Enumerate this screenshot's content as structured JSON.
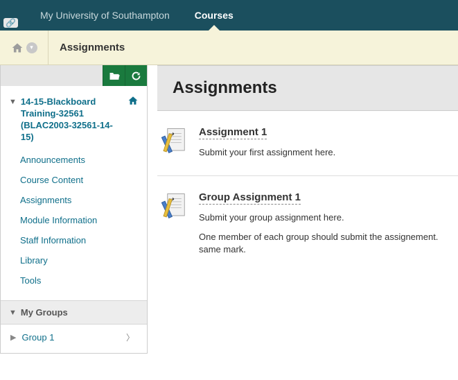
{
  "topnav": {
    "items": [
      {
        "label": "My University of Southampton",
        "active": false
      },
      {
        "label": "Courses",
        "active": true
      }
    ]
  },
  "breadcrumb": {
    "title": "Assignments"
  },
  "sidebar": {
    "course_title": "14-15-Blackboard Training-32561 (BLAC2003-32561-14-15)",
    "links": [
      "Announcements",
      "Course Content",
      "Assignments",
      "Module Information",
      "Staff Information",
      "Library",
      "Tools"
    ],
    "groups_header": "My Groups",
    "groups": [
      "Group 1"
    ]
  },
  "page": {
    "title": "Assignments",
    "items": [
      {
        "title": "Assignment 1",
        "lines": [
          "Submit your first assignment here."
        ]
      },
      {
        "title": "Group Assignment 1",
        "lines": [
          "Submit your group assignment here.",
          "One member of each group should submit the assignement. same mark."
        ]
      }
    ]
  }
}
